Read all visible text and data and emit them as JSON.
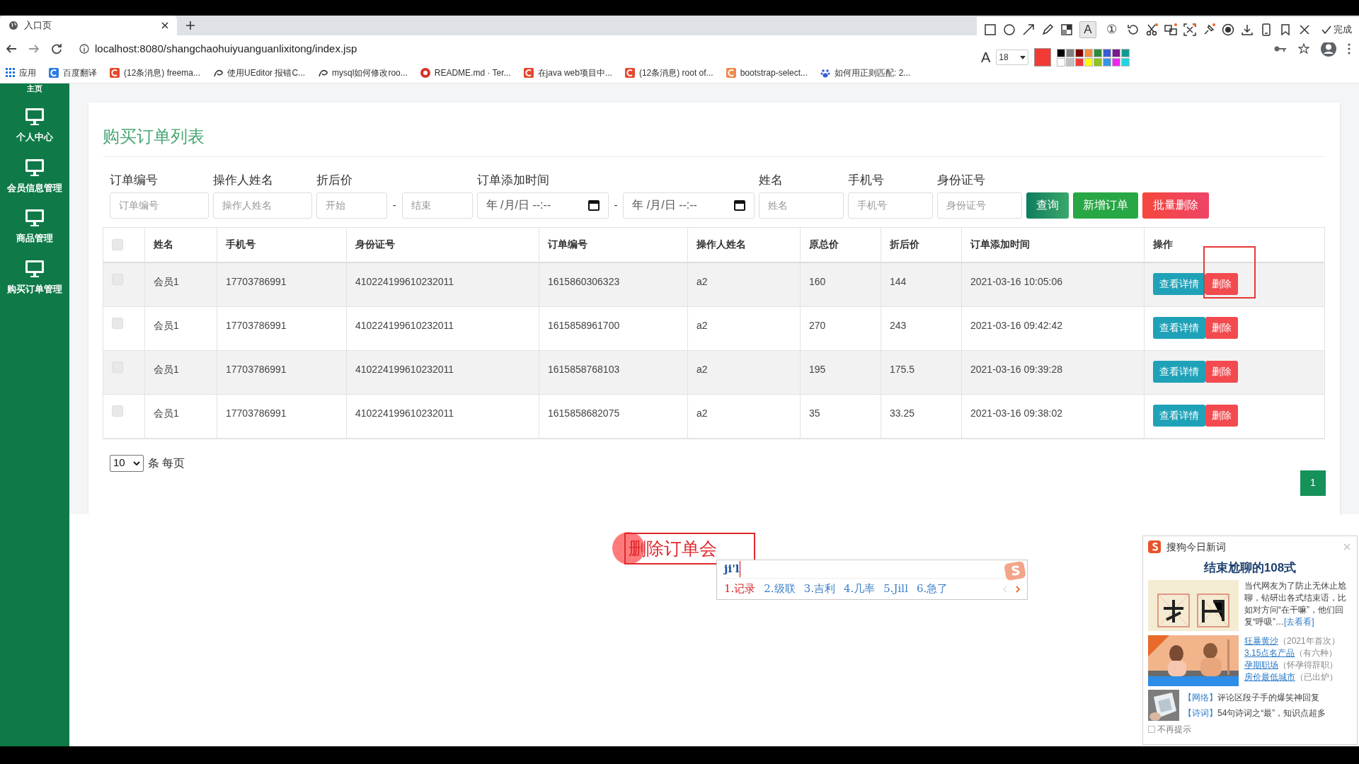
{
  "browser": {
    "tab_title": "入口页",
    "url": "localhost:8080/shangchaohuiyuanguanlixitong/index.jsp",
    "bookmarks": [
      {
        "kind": "apps",
        "label": "应用",
        "color": "#1a73e8"
      },
      {
        "kind": "square",
        "label": "百度翻译",
        "color": "#2f7de1"
      },
      {
        "kind": "square",
        "label": "(12条消息) freema...",
        "color": "#e5482e"
      },
      {
        "kind": "swirl",
        "label": "使用UEditor 报错C...",
        "color": "#333333"
      },
      {
        "kind": "swirl",
        "label": "mysql如何修改roo...",
        "color": "#333333"
      },
      {
        "kind": "circle",
        "label": "README.md · Ter...",
        "color": "#d9322b"
      },
      {
        "kind": "square",
        "label": "在java web项目中...",
        "color": "#e5482e"
      },
      {
        "kind": "square",
        "label": "(12条消息) root of...",
        "color": "#e5482e"
      },
      {
        "kind": "square",
        "label": "bootstrap-select...",
        "color": "#f08a4b"
      },
      {
        "kind": "paw",
        "label": "如何用正则匹配: 2...",
        "color": "#3a5bd9"
      }
    ]
  },
  "screenshot_toolbar": {
    "tools": [
      {
        "kind": "rect",
        "selected": false
      },
      {
        "kind": "ellipse",
        "selected": false
      },
      {
        "kind": "arrow",
        "selected": false
      },
      {
        "kind": "pencil",
        "selected": false
      },
      {
        "kind": "mosaic",
        "selected": false
      },
      {
        "kind": "text",
        "label": "A",
        "selected": true
      },
      {
        "kind": "number",
        "label": "①",
        "selected": false
      },
      {
        "kind": "undo",
        "selected": false
      },
      {
        "kind": "cut",
        "selected": false
      },
      {
        "kind": "translate",
        "selected": false
      },
      {
        "kind": "ocr",
        "selected": false
      },
      {
        "kind": "pin",
        "selected": false
      },
      {
        "kind": "record",
        "selected": false
      },
      {
        "kind": "download",
        "selected": false
      },
      {
        "kind": "phone",
        "selected": false
      },
      {
        "kind": "bookmark",
        "selected": false
      },
      {
        "kind": "close",
        "selected": false
      }
    ],
    "done_label": "完成",
    "font_label": "A",
    "font_size": "18",
    "current": {
      "color": "#f23b35"
    },
    "swatches": [
      {
        "color": "#000000"
      },
      {
        "color": "#808080"
      },
      {
        "color": "#800000"
      },
      {
        "color": "#f58c3c"
      },
      {
        "color": "#2e8b3a"
      },
      {
        "color": "#3b5bd6"
      },
      {
        "color": "#7b1a8a"
      },
      {
        "color": "#139a92"
      },
      {
        "color": "#ffffff"
      },
      {
        "color": "#c0c0c0"
      },
      {
        "color": "#ef3b3b"
      },
      {
        "color": "#ffff00"
      },
      {
        "color": "#8fc31f"
      },
      {
        "color": "#3b93e6"
      },
      {
        "color": "#f025f0"
      },
      {
        "color": "#22d3de"
      }
    ]
  },
  "sidebar": {
    "items": [
      {
        "label": "主页"
      },
      {
        "label": "个人中心"
      },
      {
        "label": "会员信息管理"
      },
      {
        "label": "商品管理"
      },
      {
        "label": "购买订单管理"
      }
    ]
  },
  "page": {
    "title": "购买订单列表",
    "filters": [
      {
        "kind": "text",
        "label": "订单编号",
        "placeholders": [
          "订单编号"
        ]
      },
      {
        "kind": "text",
        "label": "操作人姓名",
        "placeholders": [
          "操作人姓名"
        ]
      },
      {
        "kind": "range",
        "label": "折后价",
        "placeholders": [
          "开始",
          "结束"
        ],
        "separator": "-"
      },
      {
        "kind": "datetime-range",
        "label": "订单添加时间",
        "values": [
          "年 /月/日 --:--",
          "年 /月/日 --:--"
        ],
        "separator": "-"
      },
      {
        "kind": "text",
        "label": "姓名",
        "placeholders": [
          "姓名"
        ]
      },
      {
        "kind": "text",
        "label": "手机号",
        "placeholders": [
          "手机号"
        ]
      },
      {
        "kind": "text",
        "label": "身份证号",
        "placeholders": [
          "身份证号"
        ]
      }
    ],
    "buttons": [
      {
        "kind": "query",
        "label": "查询"
      },
      {
        "kind": "add",
        "label": "新增订单"
      },
      {
        "kind": "batch-delete",
        "label": "批量删除"
      }
    ]
  },
  "table": {
    "header_checked": false,
    "columns": [
      "姓名",
      "手机号",
      "身份证号",
      "订单编号",
      "操作人姓名",
      "原总价",
      "折后价",
      "订单添加时间",
      "操作"
    ],
    "rows": [
      {
        "checked": false,
        "cells": [
          "会员1",
          "17703786991",
          "410224199610232011",
          "1615860306323",
          "a2",
          "160",
          "144",
          "2021-03-16 10:05:06"
        ],
        "actions": [
          "查看详情",
          "删除"
        ]
      },
      {
        "checked": false,
        "cells": [
          "会员1",
          "17703786991",
          "410224199610232011",
          "1615858961700",
          "a2",
          "270",
          "243",
          "2021-03-16 09:42:42"
        ],
        "actions": [
          "查看详情",
          "删除"
        ]
      },
      {
        "checked": false,
        "cells": [
          "会员1",
          "17703786991",
          "410224199610232011",
          "1615858768103",
          "a2",
          "195",
          "175.5",
          "2021-03-16 09:39:28"
        ],
        "actions": [
          "查看详情",
          "删除"
        ]
      },
      {
        "checked": false,
        "cells": [
          "会员1",
          "17703786991",
          "410224199610232011",
          "1615858682075",
          "a2",
          "35",
          "33.25",
          "2021-03-16 09:38:02"
        ],
        "actions": [
          "查看详情",
          "删除"
        ]
      }
    ]
  },
  "pagination": {
    "page_size": "10",
    "page_size_suffix": "条 每页",
    "pages": [
      {
        "label": "1",
        "selected": true
      }
    ]
  },
  "annotation": {
    "text": "删除订单会"
  },
  "ime": {
    "input": "ji'l",
    "candidates": [
      {
        "label": "1.记录",
        "selected": true
      },
      {
        "label": "2.级联",
        "selected": false
      },
      {
        "label": "3.吉利",
        "selected": false
      },
      {
        "label": "4.几率",
        "selected": false
      },
      {
        "label": "5.Jill",
        "selected": false
      },
      {
        "label": "6.急了",
        "selected": false
      }
    ]
  },
  "news_popup": {
    "title": "搜狗今日新词",
    "headline": "结束尬聊的108式",
    "summary": "当代网友为了防止无休止尬聊，钻研出各式结束语，比如对方问“在干嘛”，他们回复“呼吸”…",
    "summary_link": "[去看看]",
    "hot_words": [
      {
        "word": "狂暴黄沙",
        "note": "（2021年首次）"
      },
      {
        "word": "3.15点名产品",
        "note": "（有六种）"
      },
      {
        "word": "孕期职场",
        "note": "（怀孕得辞职）"
      },
      {
        "word": "房价最低城市",
        "note": "（已出炉）"
      }
    ],
    "items": [
      {
        "tag": "【网络】",
        "text": "评论区段子手的爆笑神回复"
      },
      {
        "tag": "【诗词】",
        "text": "54句诗词之“最”，知识点超多"
      }
    ],
    "dont_show_again": {
      "label": "不再提示",
      "checked": false
    }
  }
}
